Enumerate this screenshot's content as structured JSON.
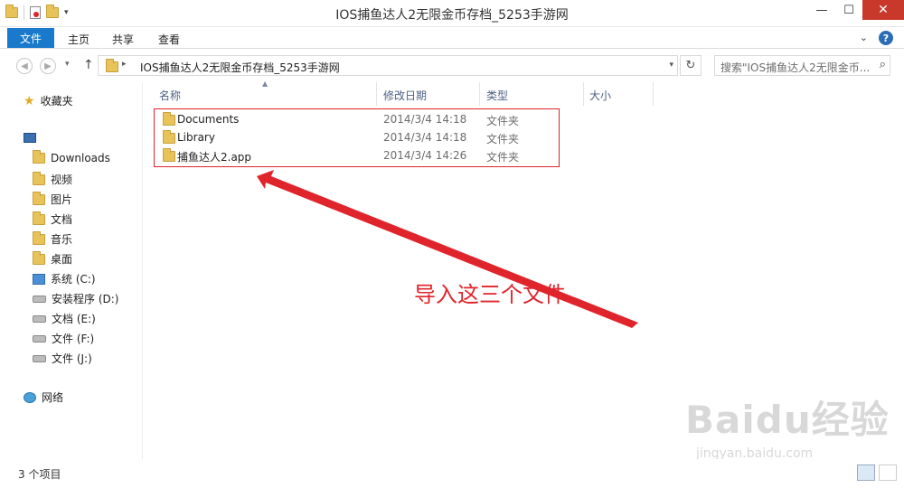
{
  "window": {
    "title": "IOS捕鱼达人2无限金币存档_5253手游网",
    "minimize": "—",
    "maximize": "☐",
    "close": "✕"
  },
  "ribbon": {
    "file_tab": "文件",
    "tabs": [
      "主页",
      "共享",
      "查看"
    ],
    "help": "?"
  },
  "address": {
    "path": "IOS捕鱼达人2无限金币存档_5253手游网",
    "search_placeholder": "搜索\"IOS捕鱼达人2无限金币..."
  },
  "sidebar": {
    "favorites": "收藏夹",
    "items": [
      {
        "label": "Downloads",
        "icon": "folder-icon"
      },
      {
        "label": "视频",
        "icon": "folder-icon"
      },
      {
        "label": "图片",
        "icon": "folder-icon"
      },
      {
        "label": "文档",
        "icon": "folder-icon"
      },
      {
        "label": "音乐",
        "icon": "folder-icon"
      },
      {
        "label": "桌面",
        "icon": "folder-icon"
      },
      {
        "label": "系统 (C:)",
        "icon": "drive-icon"
      },
      {
        "label": "安装程序 (D:)",
        "icon": "drive-icon"
      },
      {
        "label": "文档 (E:)",
        "icon": "drive-icon"
      },
      {
        "label": "文件 (F:)",
        "icon": "drive-icon"
      },
      {
        "label": "文件 (J:)",
        "icon": "drive-icon"
      }
    ],
    "network": "网络"
  },
  "columns": {
    "name": "名称",
    "modified": "修改日期",
    "type": "类型",
    "size": "大小"
  },
  "files": [
    {
      "name": "Documents",
      "modified": "2014/3/4 14:18",
      "type": "文件夹"
    },
    {
      "name": "Library",
      "modified": "2014/3/4 14:18",
      "type": "文件夹"
    },
    {
      "name": "捕鱼达人2.app",
      "modified": "2014/3/4 14:26",
      "type": "文件夹"
    }
  ],
  "annotation": {
    "text": "导入这三个文件",
    "color": "#e0242b"
  },
  "watermark": {
    "brand": "Baidu经验",
    "url": "jingyan.baidu.com"
  },
  "status": {
    "count": "3 个项目"
  },
  "colors": {
    "accent": "#1979ca",
    "close": "#c8382b",
    "annotation": "#e0242b"
  }
}
